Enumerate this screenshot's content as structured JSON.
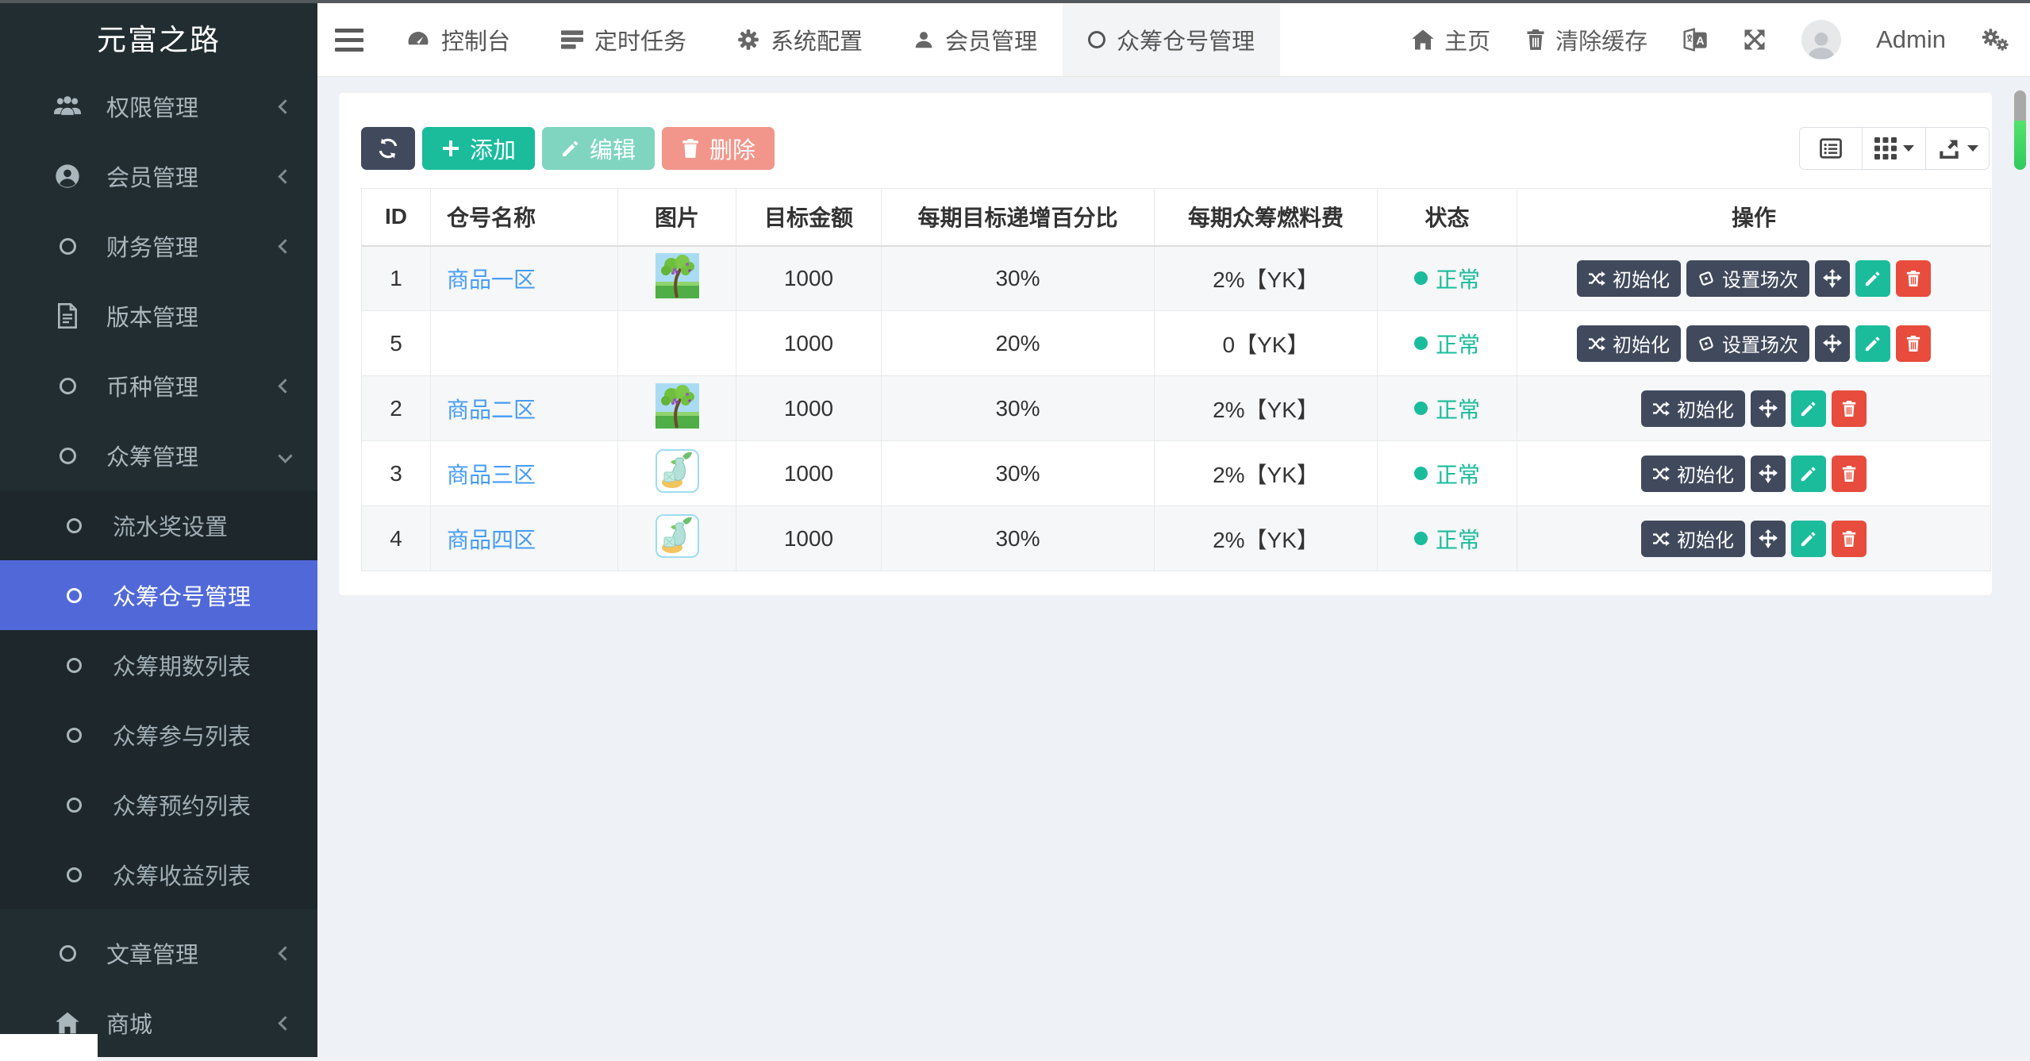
{
  "app": {
    "brand": "元富之路"
  },
  "sidebar": {
    "items": [
      {
        "label": "权限管理"
      },
      {
        "label": "会员管理"
      },
      {
        "label": "财务管理"
      },
      {
        "label": "版本管理"
      },
      {
        "label": "币种管理"
      },
      {
        "label": "众筹管理"
      }
    ],
    "submenu": [
      {
        "label": "流水奖设置"
      },
      {
        "label": "众筹仓号管理"
      },
      {
        "label": "众筹期数列表"
      },
      {
        "label": "众筹参与列表"
      },
      {
        "label": "众筹预约列表"
      },
      {
        "label": "众筹收益列表"
      }
    ],
    "bottom": [
      {
        "label": "文章管理"
      },
      {
        "label": "商城"
      }
    ],
    "active_item": "众筹仓号管理"
  },
  "navbar": {
    "tabs": [
      {
        "label": "控制台"
      },
      {
        "label": "定时任务"
      },
      {
        "label": "系统配置"
      },
      {
        "label": "会员管理"
      },
      {
        "label": "众筹仓号管理"
      }
    ],
    "home": "主页",
    "clear_cache": "清除缓存",
    "username": "Admin"
  },
  "toolbar": {
    "add": "添加",
    "edit": "编辑",
    "delete": "删除"
  },
  "table": {
    "headers": [
      "ID",
      "仓号名称",
      "图片",
      "目标金额",
      "每期目标递增百分比",
      "每期众筹燃料费",
      "状态",
      "操作"
    ],
    "actions": {
      "init": "初始化",
      "setup": "设置场次"
    },
    "rows": [
      {
        "id": "1",
        "name": "商品一区",
        "amount": "1000",
        "increase": "30%",
        "fuel": "2%【YK】",
        "status": "正常"
      },
      {
        "id": "5",
        "name": "",
        "amount": "1000",
        "increase": "20%",
        "fuel": "0【YK】",
        "status": "正常"
      },
      {
        "id": "2",
        "name": "商品二区",
        "amount": "1000",
        "increase": "30%",
        "fuel": "2%【YK】",
        "status": "正常"
      },
      {
        "id": "3",
        "name": "商品三区",
        "amount": "1000",
        "increase": "30%",
        "fuel": "2%【YK】",
        "status": "正常"
      },
      {
        "id": "4",
        "name": "商品四区",
        "amount": "1000",
        "increase": "30%",
        "fuel": "2%【YK】",
        "status": "正常"
      }
    ]
  },
  "colors": {
    "sidebar_bg": "#222d32",
    "active_menu": "#5169d8",
    "accent_green": "#1abc9c",
    "accent_red": "#e74c3c",
    "dark_button": "#414a5c",
    "link": "#469cf6",
    "status": "#1abc9c"
  }
}
